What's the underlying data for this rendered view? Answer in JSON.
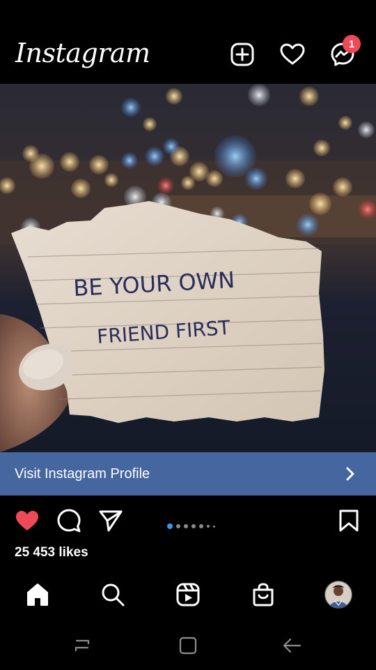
{
  "app": {
    "logo_text": "Instagram"
  },
  "header": {
    "messenger_badge_count": "1"
  },
  "post": {
    "photo_note_line1": "BE YOUR OWN",
    "photo_note_line2": "FRIEND  FIRST",
    "profile_cta": "Visit Instagram Profile",
    "likes_text": "25 453 likes",
    "liked": true,
    "carousel_total": 7,
    "carousel_active": 1
  },
  "icons": {
    "header": [
      "add-post-icon",
      "heart-icon",
      "messenger-icon"
    ],
    "actions": [
      "like-icon",
      "comment-icon",
      "share-icon",
      "bookmark-icon"
    ],
    "bottom_nav": [
      "home-icon",
      "search-icon",
      "reels-icon",
      "shop-icon",
      "profile-avatar"
    ],
    "system": [
      "recent-apps-icon",
      "home-button-icon",
      "back-icon"
    ]
  },
  "colors": {
    "background": "#000000",
    "cta_bar": "#4666a0",
    "badge": "#ed4956",
    "like_red": "#ed4956",
    "carousel_active": "#3897f0"
  }
}
